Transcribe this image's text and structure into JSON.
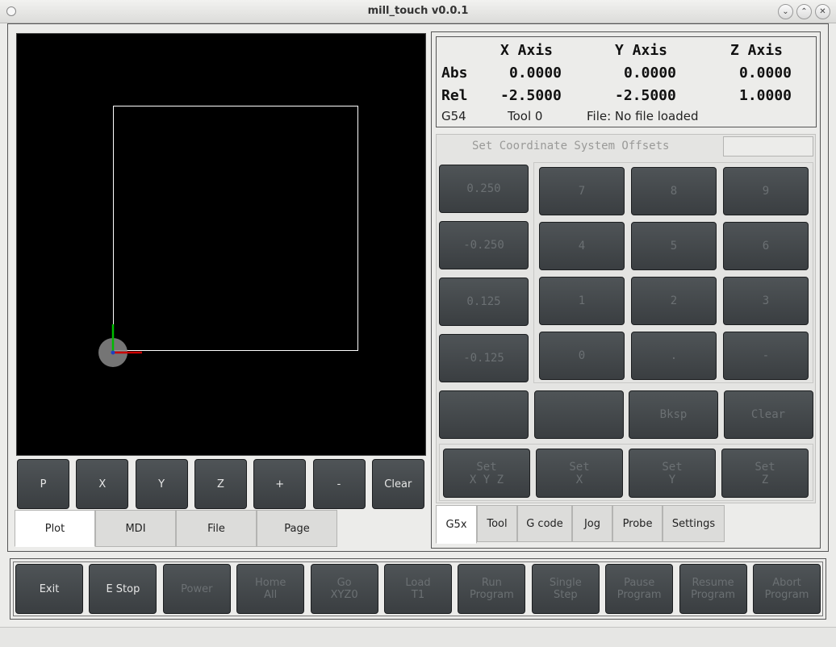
{
  "window": {
    "title": "mill_touch v0.0.1"
  },
  "plot_buttons": [
    "P",
    "X",
    "Y",
    "Z",
    "+",
    "-",
    "Clear"
  ],
  "left_tabs": [
    "Plot",
    "MDI",
    "File",
    "Page"
  ],
  "dro": {
    "headers": [
      "X Axis",
      "Y Axis",
      "Z Axis"
    ],
    "abs_label": "Abs",
    "abs": [
      "0.0000",
      "0.0000",
      "0.0000"
    ],
    "rel_label": "Rel",
    "rel": [
      "-2.5000",
      "-2.5000",
      "1.0000"
    ],
    "coord_system": "G54",
    "tool": "Tool 0",
    "file": "File: No file loaded"
  },
  "offsets": {
    "title": "Set Coordinate System Offsets",
    "entry_value": "",
    "increments": [
      "0.250",
      "-0.250",
      "0.125",
      "-0.125"
    ],
    "digits": [
      "7",
      "8",
      "9",
      "4",
      "5",
      "6",
      "1",
      "2",
      "3",
      "0",
      ".",
      "-"
    ],
    "row_buttons": [
      "",
      "",
      "Bksp",
      "Clear"
    ],
    "set_buttons": [
      [
        "Set",
        "X Y Z"
      ],
      [
        "Set",
        "X"
      ],
      [
        "Set",
        "Y"
      ],
      [
        "Set",
        "Z"
      ]
    ]
  },
  "right_tabs": [
    "G5x",
    "Tool",
    "G code",
    "Jog",
    "Probe",
    "Settings"
  ],
  "bottom_buttons": [
    {
      "l1": "Exit",
      "l2": ""
    },
    {
      "l1": "E Stop",
      "l2": ""
    },
    {
      "l1": "Power",
      "l2": ""
    },
    {
      "l1": "Home",
      "l2": "All"
    },
    {
      "l1": "Go",
      "l2": "XYZ0"
    },
    {
      "l1": "Load",
      "l2": "T1"
    },
    {
      "l1": "Run",
      "l2": "Program"
    },
    {
      "l1": "Single",
      "l2": "Step"
    },
    {
      "l1": "Pause",
      "l2": "Program"
    },
    {
      "l1": "Resume",
      "l2": "Program"
    },
    {
      "l1": "Abort",
      "l2": "Program"
    }
  ],
  "colors": {
    "plot_bg": "#000000",
    "button": "#45494c",
    "x_axis": "#cc0000",
    "y_axis": "#00cc00"
  }
}
